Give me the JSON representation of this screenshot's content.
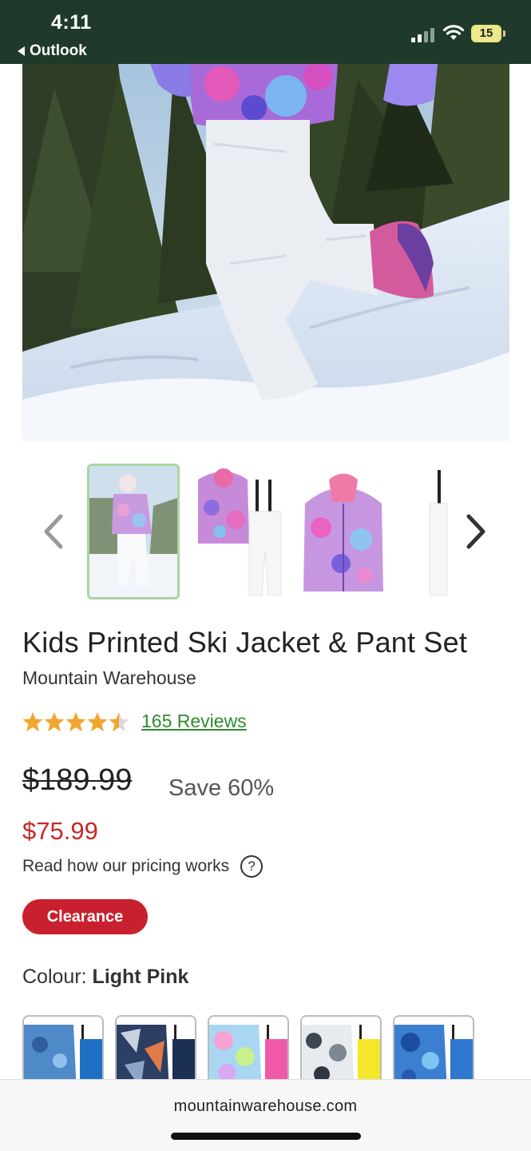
{
  "status_bar": {
    "time": "4:11",
    "back_app": "Outlook",
    "battery": "15",
    "icons": [
      "signal-icon",
      "wifi-icon",
      "battery-icon"
    ]
  },
  "gallery": {
    "hero_image": "Child in printed ski jacket and white ski pants running in snow",
    "thumbnails": [
      "child-model-thumbnail",
      "jacket-and-pants-set-thumbnail",
      "jacket-thumbnail",
      "pants-thumbnail"
    ],
    "active_index": 0,
    "prev_icon": "chevron-left-icon",
    "next_icon": "chevron-right-icon"
  },
  "product": {
    "title": "Kids Printed Ski Jacket & Pant Set",
    "brand": "Mountain Warehouse",
    "rating": 4.5,
    "rating_max": 5,
    "reviews_label": "165 Reviews",
    "price_original": "$189.99",
    "save_label": "Save 60%",
    "price_current": "$75.99",
    "pricing_link": "Read how our pricing works",
    "help_glyph": "?",
    "badge": "Clearance",
    "colour_label": "Colour:",
    "colour_value": "Light Pink"
  },
  "swatches": [
    "blue-camo-swatch",
    "navy-geometric-swatch",
    "pastel-rainbow-swatch",
    "grey-camo-swatch",
    "blue-tie-dye-swatch"
  ],
  "browser": {
    "url": "mountainwarehouse.com"
  },
  "colors": {
    "status_bg": "#1f3a2b",
    "accent_red": "#c62828",
    "badge_red": "#c8202e",
    "link_green": "#2e8b2e",
    "star_gold": "#f2a531",
    "thumb_border": "#a9d6a3"
  }
}
